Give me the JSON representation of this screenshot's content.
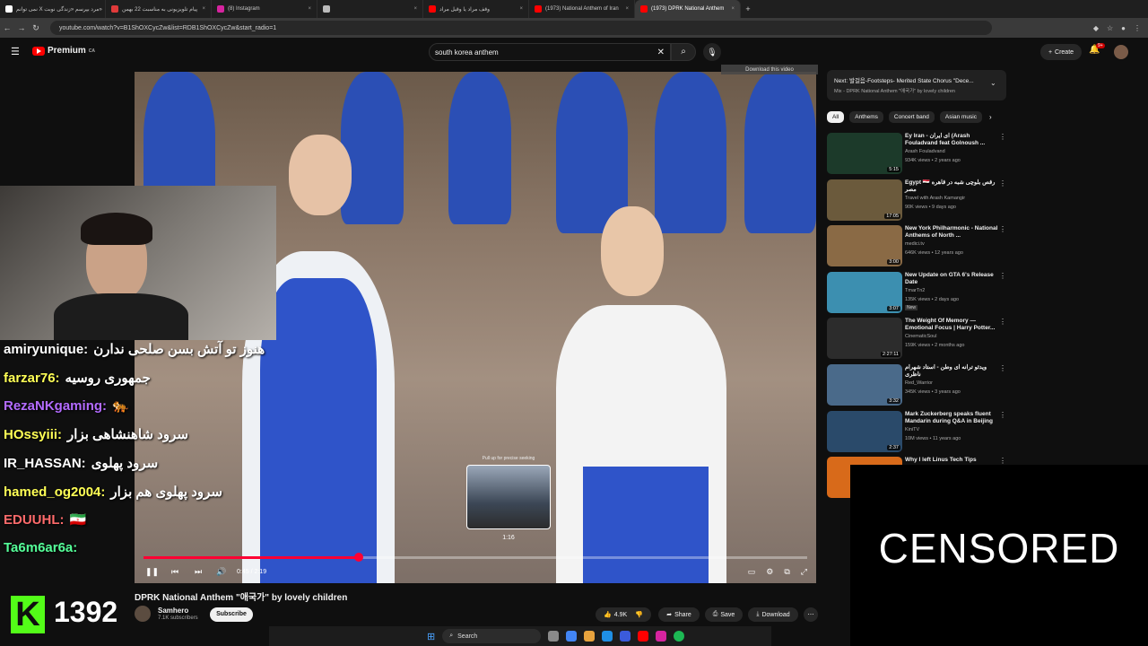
{
  "tabs": [
    {
      "label": "نمی توانم X مرد بپرسم «زندگی نوبت»",
      "color": "#ffffff"
    },
    {
      "label": "پیام تلویزیونی به مناسبت 22 بهمن",
      "color": "#e03a3a"
    },
    {
      "label": "(8) Instagram",
      "color": "#d6249f"
    },
    {
      "label": "",
      "color": "#bbbbbb"
    },
    {
      "label": "وقف مراد یا وقیل مراد",
      "color": "#ff0000"
    },
    {
      "label": "(1973) National Anthem of Iran",
      "color": "#ff0000"
    },
    {
      "label": "(1973) DPRK National Anthem",
      "color": "#ff0000"
    }
  ],
  "url": "youtube.com/watch?v=B1ShOXCycZw&list=RDB1ShOXCycZw&start_radio=1",
  "header": {
    "logo": "Premium",
    "country": "CA",
    "search_value": "south korea anthem",
    "create_label": "Create",
    "notif_count": "9+"
  },
  "video": {
    "download_banner": "Download this video",
    "preview_hint": "Pull up for precise seeking",
    "preview_time": "1:16",
    "time": "0:45 / 2:19",
    "progress": 0.324,
    "title": "DPRK National Anthem \"애국가\" by lovely children",
    "channel": "Samhero",
    "subscribers": "7.1K subscribers",
    "subscribe": "Subscribe",
    "likes": "4.9K",
    "share": "Share",
    "save": "Save",
    "download": "Download"
  },
  "upnext": {
    "label": "Next: 발걸음-Footsteps- Merited State Chorus \"Dece...",
    "sub": "Mix - DPRK National Anthem \"애국가\" by lovely children"
  },
  "chips": [
    "All",
    "Anthems",
    "Concert band",
    "Asian music"
  ],
  "recommendations": [
    {
      "title": "Ey Iran - ای ایران (Arash Fouladvand feat Golnoush ...",
      "channel": "Arash Fouladvand",
      "meta": "934K views • 2 years ago",
      "duration": "5:15",
      "thumb": "#1c3a2a"
    },
    {
      "title": "Egypt 🇪🇬 رقص بلوچی شبه در قاهره مصر",
      "channel": "Travel with Arash Kamangir",
      "meta": "90K views • 9 days ago",
      "duration": "17:05",
      "thumb": "#6b5a3c"
    },
    {
      "title": "New York Philharmonic - National Anthems of North ...",
      "channel": "medici.tv",
      "meta": "646K views • 12 years ago",
      "duration": "3:00",
      "thumb": "#8a6a45"
    },
    {
      "title": "New Update on GTA 6's Release Date",
      "channel": "TmarTn2",
      "meta": "135K views • 2 days ago",
      "duration": "3:07",
      "thumb": "#3c8fb0",
      "badge": "New"
    },
    {
      "title": "The Weight Of Memory — Emotional Focus | Harry Potter...",
      "channel": "CinematicSoul",
      "meta": "159K views • 2 months ago",
      "duration": "2:27:11",
      "thumb": "#2c2c2c"
    },
    {
      "title": "ویدئو ترانه ای وطن - استاد شهرام ناظری",
      "channel": "Red_Warrior",
      "meta": "345K views • 3 years ago",
      "duration": "3:32",
      "thumb": "#4a6a8a"
    },
    {
      "title": "Mark Zuckerberg speaks fluent Mandarin during Q&A in Beijing",
      "channel": "KiniTV",
      "meta": "10M views • 11 years ago",
      "duration": "2:37",
      "thumb": "#2a4a6a"
    },
    {
      "title": "Why I left Linus Tech Tips",
      "channel": "",
      "meta": "",
      "duration": "",
      "thumb": "#d86a1a"
    }
  ],
  "chat": [
    {
      "user": "amiryunique:",
      "msg": "هنوز تو آتش بسن صلحی ندارن",
      "color": "#ffffff"
    },
    {
      "user": "farzar76:",
      "msg": "جمهوری روسیه",
      "color": "#ffff55"
    },
    {
      "user": "RezaNKgaming:",
      "msg": "🐅",
      "color": "#b36bff"
    },
    {
      "user": "HOssyiii:",
      "msg": "سرود شاهنشاهی بزار",
      "color": "#ffff55"
    },
    {
      "user": "IR_HASSAN:",
      "msg": "سرود پهلوی",
      "color": "#ffffff"
    },
    {
      "user": "hamed_og2004:",
      "msg": "سرود پهلوی هم بزار",
      "color": "#ffff55"
    },
    {
      "user": "EDUUHL:",
      "msg": "🇮🇷",
      "color": "#ff6b6b"
    },
    {
      "user": "Ta6m6ar6a:",
      "msg": "",
      "color": "#55ff99"
    }
  ],
  "viewer_count": "1392",
  "censored_label": "CENSORED",
  "taskbar": {
    "search": "Search"
  }
}
